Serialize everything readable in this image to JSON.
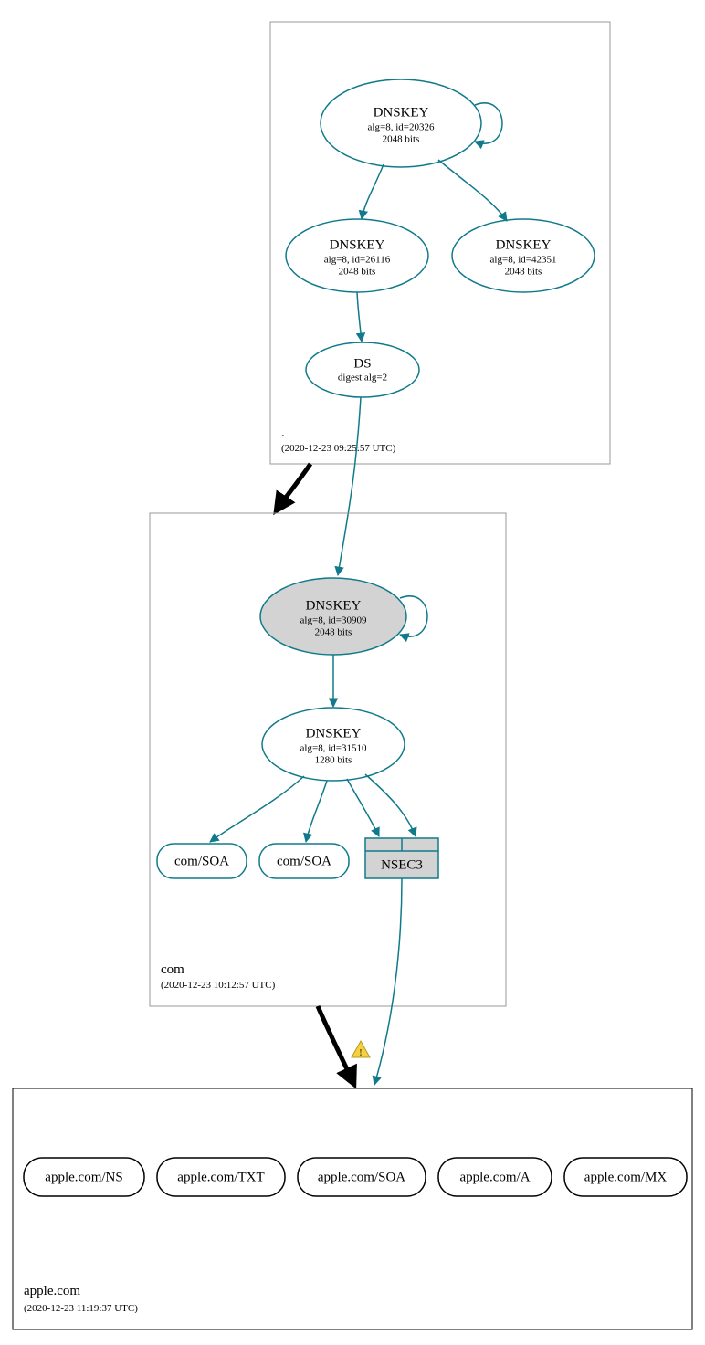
{
  "colors": {
    "teal": "#107a8b",
    "grey_fill": "#d3d3d3",
    "box_grey": "#999999",
    "black": "#000000",
    "warn_fill": "#f4d142",
    "warn_stroke": "#b89a1f"
  },
  "zones": {
    "root": {
      "label": ".",
      "timestamp": "(2020-12-23 09:25:57 UTC)"
    },
    "com": {
      "label": "com",
      "timestamp": "(2020-12-23 10:12:57 UTC)"
    },
    "apple": {
      "label": "apple.com",
      "timestamp": "(2020-12-23 11:19:37 UTC)"
    }
  },
  "nodes": {
    "root_ksk": {
      "title": "DNSKEY",
      "line1": "alg=8, id=20326",
      "line2": "2048 bits"
    },
    "root_zsk1": {
      "title": "DNSKEY",
      "line1": "alg=8, id=26116",
      "line2": "2048 bits"
    },
    "root_zsk2": {
      "title": "DNSKEY",
      "line1": "alg=8, id=42351",
      "line2": "2048 bits"
    },
    "root_ds": {
      "title": "DS",
      "line1": "digest alg=2"
    },
    "com_ksk": {
      "title": "DNSKEY",
      "line1": "alg=8, id=30909",
      "line2": "2048 bits"
    },
    "com_zsk": {
      "title": "DNSKEY",
      "line1": "alg=8, id=31510",
      "line2": "1280 bits"
    },
    "com_soa1": {
      "title": "com/SOA"
    },
    "com_soa2": {
      "title": "com/SOA"
    },
    "com_nsec3": {
      "title": "NSEC3"
    },
    "apple_ns": {
      "title": "apple.com/NS"
    },
    "apple_txt": {
      "title": "apple.com/TXT"
    },
    "apple_soa": {
      "title": "apple.com/SOA"
    },
    "apple_a": {
      "title": "apple.com/A"
    },
    "apple_mx": {
      "title": "apple.com/MX"
    }
  },
  "chart_data": {
    "type": "graph",
    "description": "DNSSEC authentication chain (DNSViz style)",
    "zones": [
      {
        "name": ".",
        "timestamp": "2020-12-23 09:25:57 UTC"
      },
      {
        "name": "com",
        "timestamp": "2020-12-23 10:12:57 UTC"
      },
      {
        "name": "apple.com",
        "timestamp": "2020-12-23 11:19:37 UTC"
      }
    ],
    "nodes": [
      {
        "id": "root_ksk",
        "zone": ".",
        "type": "DNSKEY",
        "alg": 8,
        "key_id": 20326,
        "bits": 2048,
        "sep": true,
        "trust_anchor": true
      },
      {
        "id": "root_zsk1",
        "zone": ".",
        "type": "DNSKEY",
        "alg": 8,
        "key_id": 26116,
        "bits": 2048,
        "sep": false
      },
      {
        "id": "root_zsk2",
        "zone": ".",
        "type": "DNSKEY",
        "alg": 8,
        "key_id": 42351,
        "bits": 2048,
        "sep": false
      },
      {
        "id": "root_ds",
        "zone": ".",
        "type": "DS",
        "digest_alg": 2
      },
      {
        "id": "com_ksk",
        "zone": "com",
        "type": "DNSKEY",
        "alg": 8,
        "key_id": 30909,
        "bits": 2048,
        "sep": true
      },
      {
        "id": "com_zsk",
        "zone": "com",
        "type": "DNSKEY",
        "alg": 8,
        "key_id": 31510,
        "bits": 1280,
        "sep": false
      },
      {
        "id": "com_soa1",
        "zone": "com",
        "type": "RRset",
        "name": "com/SOA"
      },
      {
        "id": "com_soa2",
        "zone": "com",
        "type": "RRset",
        "name": "com/SOA"
      },
      {
        "id": "com_nsec3",
        "zone": "com",
        "type": "NSEC3"
      },
      {
        "id": "apple_ns",
        "zone": "apple.com",
        "type": "RRset",
        "name": "apple.com/NS"
      },
      {
        "id": "apple_txt",
        "zone": "apple.com",
        "type": "RRset",
        "name": "apple.com/TXT"
      },
      {
        "id": "apple_soa",
        "zone": "apple.com",
        "type": "RRset",
        "name": "apple.com/SOA"
      },
      {
        "id": "apple_a",
        "zone": "apple.com",
        "type": "RRset",
        "name": "apple.com/A"
      },
      {
        "id": "apple_mx",
        "zone": "apple.com",
        "type": "RRset",
        "name": "apple.com/MX"
      }
    ],
    "edges": [
      {
        "from": "root_ksk",
        "to": "root_ksk",
        "kind": "self-sig",
        "color": "teal"
      },
      {
        "from": "root_ksk",
        "to": "root_zsk1",
        "kind": "sig",
        "color": "teal"
      },
      {
        "from": "root_ksk",
        "to": "root_zsk2",
        "kind": "sig",
        "color": "teal"
      },
      {
        "from": "root_zsk1",
        "to": "root_ds",
        "kind": "sig",
        "color": "teal"
      },
      {
        "from": "root_ds",
        "to": "com_ksk",
        "kind": "ds-match",
        "color": "teal"
      },
      {
        "from": "root_zone",
        "to": "com_zone",
        "kind": "delegation",
        "color": "black",
        "thick": true
      },
      {
        "from": "com_ksk",
        "to": "com_ksk",
        "kind": "self-sig",
        "color": "teal"
      },
      {
        "from": "com_ksk",
        "to": "com_zsk",
        "kind": "sig",
        "color": "teal"
      },
      {
        "from": "com_zsk",
        "to": "com_soa1",
        "kind": "sig",
        "color": "teal"
      },
      {
        "from": "com_zsk",
        "to": "com_soa2",
        "kind": "sig",
        "color": "teal"
      },
      {
        "from": "com_zsk",
        "to": "com_nsec3",
        "kind": "sig",
        "color": "teal"
      },
      {
        "from": "com_nsec3",
        "to": "apple_zone",
        "kind": "nsec3-proof",
        "color": "teal"
      },
      {
        "from": "com_zone",
        "to": "apple_zone",
        "kind": "delegation",
        "color": "black",
        "thick": true,
        "warning": true
      }
    ]
  }
}
